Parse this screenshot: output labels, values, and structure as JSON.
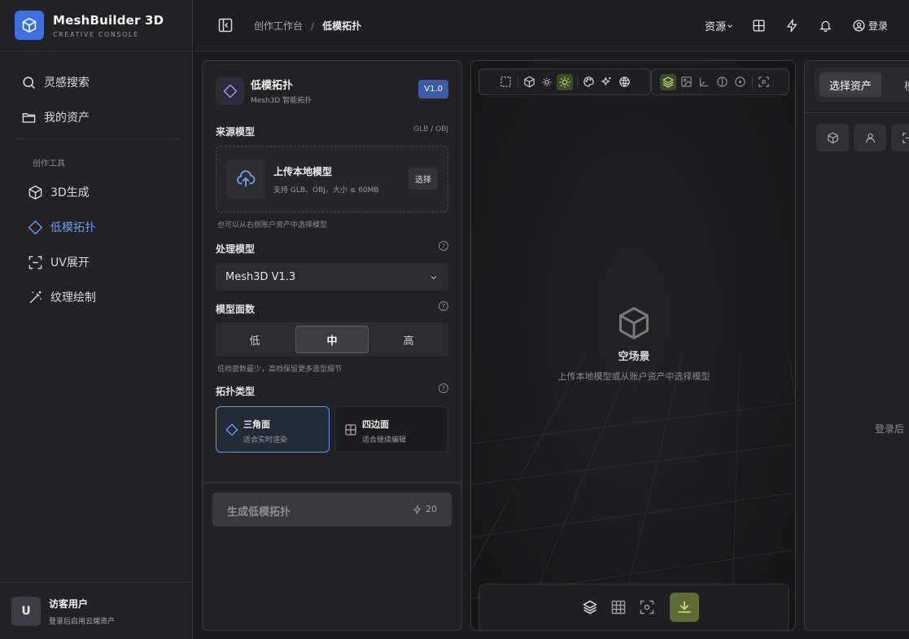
{
  "brand": {
    "name": "MeshBuilder 3D",
    "subtitle": "CREATIVE CONSOLE"
  },
  "sidebar": {
    "items": [
      {
        "label": "灵感搜索",
        "icon": "search-icon"
      },
      {
        "label": "我的资产",
        "icon": "folder-icon"
      }
    ],
    "section_label": "创作工具",
    "tools": [
      {
        "label": "3D生成",
        "icon": "cube-icon"
      },
      {
        "label": "低模拓扑",
        "icon": "diamond-icon",
        "active": true
      },
      {
        "label": "UV展开",
        "icon": "uv-frame-icon"
      },
      {
        "label": "纹理绘制",
        "icon": "magic-wand-icon"
      }
    ],
    "user": {
      "avatar": "U",
      "name": "访客用户",
      "hint": "登录后启用云端资产"
    }
  },
  "topbar": {
    "breadcrumb": [
      "创作工作台",
      "/",
      "低模拓扑"
    ],
    "resources_label": "资源",
    "login_label": "登录"
  },
  "panel": {
    "title": "低模拓扑",
    "subtitle": "Mesh3D 智能拓扑",
    "version": "V1.0",
    "source": {
      "label": "来源模型",
      "formats": "GLB / OBJ",
      "upload_title": "上传本地模型",
      "upload_sub": "支持 GLB、OBJ，大小 ≤ 60MB",
      "upload_button": "选择",
      "hint": "也可以从右侧账户资产中选择模型"
    },
    "model": {
      "label": "处理模型",
      "selected": "Mesh3D V1.3"
    },
    "faces": {
      "label": "模型面数",
      "options": [
        "低",
        "中",
        "高"
      ],
      "selected": "中",
      "hint": "低档面数最少，高档保留更多造型细节"
    },
    "topology": {
      "label": "拓扑类型",
      "options": [
        {
          "title": "三角面",
          "sub": "适合实时渲染",
          "selected": true
        },
        {
          "title": "四边面",
          "sub": "适合继续编辑",
          "selected": false
        }
      ]
    },
    "generate": {
      "label": "生成低模拓扑",
      "cost": "20"
    }
  },
  "viewport": {
    "empty_title": "空场景",
    "empty_sub": "上传本地模型或从账户资产中选择模型"
  },
  "right_panel": {
    "tabs": [
      "选择资产",
      "模型"
    ],
    "message": "登录后"
  },
  "colors": {
    "accent": "#3b6ee0",
    "active_nav": "#6b97f0",
    "download": "#5f6b34",
    "highlight_green": "#b7d36a"
  }
}
